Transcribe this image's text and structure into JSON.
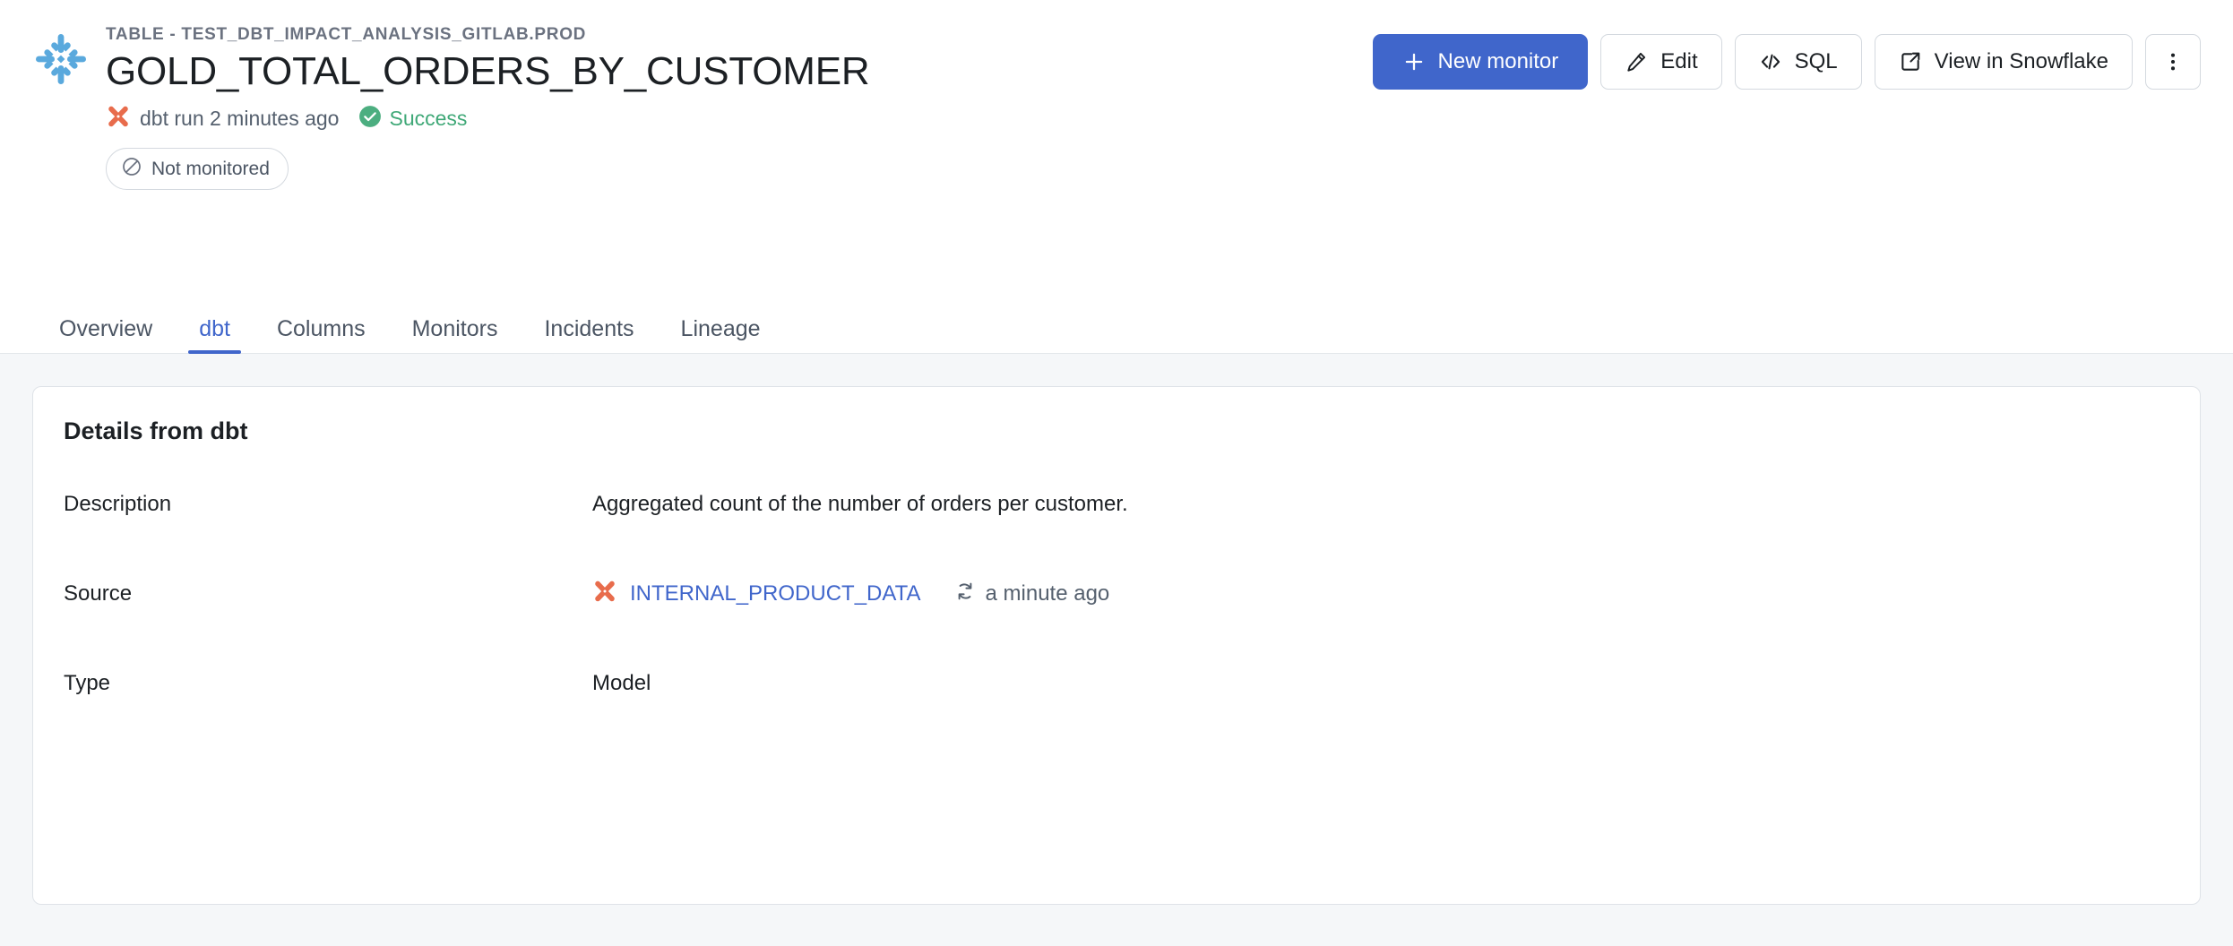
{
  "header": {
    "platform_icon": "snowflake-icon",
    "breadcrumb": "TABLE - TEST_DBT_IMPACT_ANALYSIS_GITLAB.PROD",
    "title": "GOLD_TOTAL_ORDERS_BY_CUSTOMER",
    "run_icon": "dbt-icon",
    "run_text": "dbt run 2 minutes ago",
    "status_icon": "check-circle-icon",
    "status_text": "Success",
    "status_color": "#3fa877",
    "monitor_badge": {
      "icon": "no-monitor-icon",
      "label": "Not monitored"
    },
    "actions": {
      "new_monitor": {
        "label": "New monitor",
        "icon": "plus-icon",
        "color": "#4066cb"
      },
      "edit": {
        "label": "Edit",
        "icon": "pencil-icon"
      },
      "sql": {
        "label": "SQL",
        "icon": "code-icon"
      },
      "view_in_snowflake": {
        "label": "View in Snowflake",
        "icon": "external-link-icon"
      },
      "more": {
        "label": "",
        "icon": "kebab-menu-icon"
      }
    }
  },
  "tabs": [
    {
      "label": "Overview",
      "active": false
    },
    {
      "label": "dbt",
      "active": true
    },
    {
      "label": "Columns",
      "active": false
    },
    {
      "label": "Monitors",
      "active": false
    },
    {
      "label": "Incidents",
      "active": false
    },
    {
      "label": "Lineage",
      "active": false
    }
  ],
  "card": {
    "title": "Details from dbt",
    "rows": [
      {
        "label": "Description",
        "value": "Aggregated count of the number of orders per customer."
      },
      {
        "label": "Source",
        "source_icon": "dbt-icon",
        "source_name": "INTERNAL_PRODUCT_DATA",
        "freshness_icon": "sync-icon",
        "freshness_text": "a minute ago"
      },
      {
        "label": "Type",
        "value": "Model"
      }
    ]
  },
  "colors": {
    "accent": "#4066cb",
    "dbt_orange": "#e86c4c",
    "snowflake_blue": "#5aa9dd",
    "success_green": "#3fa877",
    "page_background": "#f5f7f9"
  }
}
